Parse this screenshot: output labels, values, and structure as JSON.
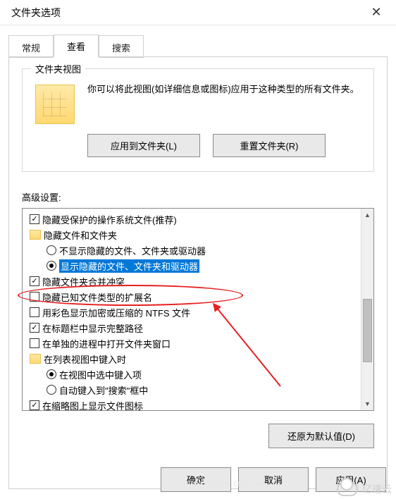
{
  "window": {
    "title": "文件夹选项",
    "close": "✕"
  },
  "tabs": {
    "general": "常规",
    "view": "查看",
    "search": "搜索"
  },
  "viewGroup": {
    "legend": "文件夹视图",
    "description": "你可以将此视图(如详细信息或图标)应用于这种类型的所有文件夹。",
    "applyBtn": "应用到文件夹(L)",
    "resetBtn": "重置文件夹(R)"
  },
  "advanced": {
    "label": "高级设置:",
    "items": [
      {
        "kind": "checkbox",
        "level": 1,
        "checked": true,
        "text": "隐藏受保护的操作系统文件(推荐)"
      },
      {
        "kind": "folder",
        "level": 1,
        "text": "隐藏文件和文件夹"
      },
      {
        "kind": "radio",
        "level": 2,
        "checked": false,
        "text": "不显示隐藏的文件、文件夹或驱动器"
      },
      {
        "kind": "radio",
        "level": 2,
        "checked": true,
        "text": "显示隐藏的文件、文件夹和驱动器",
        "highlight": true
      },
      {
        "kind": "checkbox",
        "level": 1,
        "checked": true,
        "text": "隐藏文件夹合并冲突"
      },
      {
        "kind": "checkbox",
        "level": 1,
        "checked": false,
        "text": "隐藏已知文件类型的扩展名"
      },
      {
        "kind": "checkbox",
        "level": 1,
        "checked": false,
        "text": "用彩色显示加密或压缩的 NTFS 文件"
      },
      {
        "kind": "checkbox",
        "level": 1,
        "checked": true,
        "text": "在标题栏中显示完整路径"
      },
      {
        "kind": "checkbox",
        "level": 1,
        "checked": false,
        "text": "在单独的进程中打开文件夹窗口"
      },
      {
        "kind": "folder",
        "level": 1,
        "text": "在列表视图中键入时"
      },
      {
        "kind": "radio",
        "level": 2,
        "checked": true,
        "text": "在视图中选中键入项"
      },
      {
        "kind": "radio",
        "level": 2,
        "checked": false,
        "text": "自动键入到\"搜索\"框中"
      },
      {
        "kind": "checkbox",
        "level": 1,
        "checked": true,
        "text": "在缩略图上显示文件图标"
      }
    ],
    "restoreBtn": "还原为默认值(D)"
  },
  "dialog": {
    "ok": "确定",
    "cancel": "取消",
    "apply": "应用(A)"
  },
  "watermark": "亿速云"
}
